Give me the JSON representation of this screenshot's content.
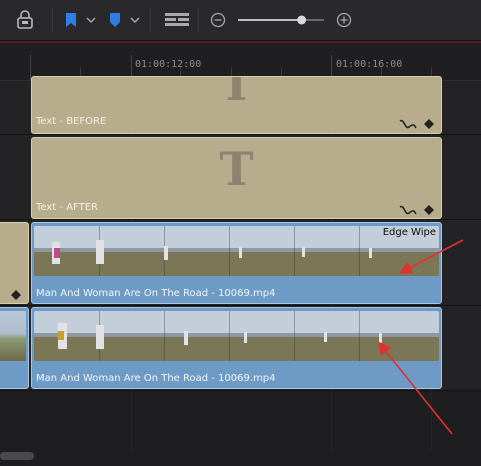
{
  "toolbar": {
    "icons": [
      "lock-icon",
      "flag-marker-icon",
      "chevron-down-icon",
      "marker-icon",
      "chevron-down-icon",
      "timeline-view-icon",
      "zoom-out-icon",
      "zoom-slider",
      "zoom-in-icon"
    ],
    "zoom_level": 0.74
  },
  "ruler": {
    "timecodes": [
      "01:00:12:00",
      "01:00:16:00"
    ]
  },
  "tracks": {
    "title_before": {
      "label": "Text - BEFORE",
      "glyph": "T"
    },
    "title_after": {
      "label": "Text - AFTER",
      "glyph": "T"
    },
    "video_upper": {
      "name": "Man And Woman Are On The Road - 10069.mp4",
      "transition": "Edge Wipe"
    },
    "video_lower": {
      "name": "Man And Woman Are On The Road - 10069.mp4"
    }
  },
  "colors": {
    "title_clip": "#b7ad8d",
    "video_clip": "#6e9bc5",
    "annotation_arrow": "#e03030"
  }
}
